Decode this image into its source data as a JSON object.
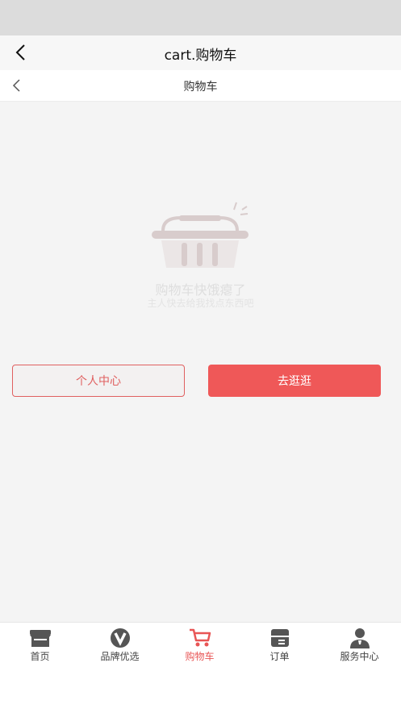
{
  "app_header": {
    "title": "cart.购物车"
  },
  "page_header": {
    "title": "购物车"
  },
  "empty_state": {
    "title": "购物车快饿瘪了",
    "subtitle": "主人快去给我找点东西吧"
  },
  "buttons": {
    "profile": "个人中心",
    "shop": "去逛逛"
  },
  "tabbar": {
    "items": [
      {
        "label": "首页",
        "icon": "store-icon"
      },
      {
        "label": "品牌优选",
        "icon": "v-badge-icon"
      },
      {
        "label": "购物车",
        "icon": "cart-icon",
        "active": true
      },
      {
        "label": "订单",
        "icon": "order-box-icon"
      },
      {
        "label": "服务中心",
        "icon": "service-person-icon"
      }
    ]
  },
  "colors": {
    "accent": "#ef5858",
    "active_tab": "#e85555",
    "icon_gray": "#555555"
  }
}
